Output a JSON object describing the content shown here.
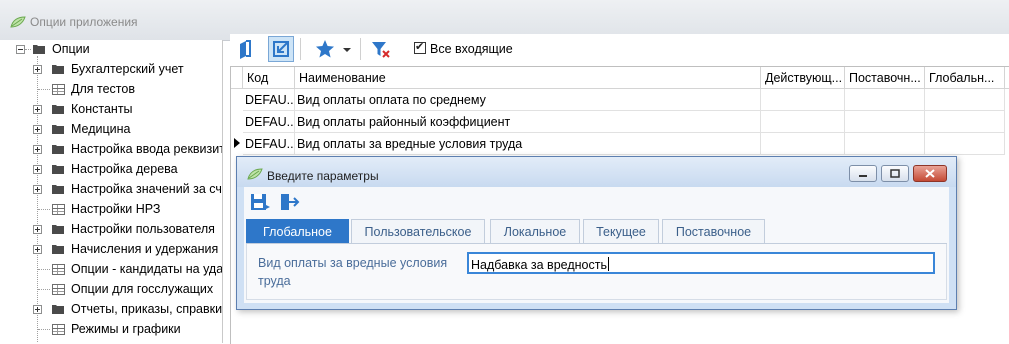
{
  "app": {
    "title": "Опции приложения"
  },
  "tree": {
    "root": "Опции",
    "items": [
      {
        "label": "Бухгалтерский учет",
        "type": "folder"
      },
      {
        "label": "Для тестов",
        "type": "table"
      },
      {
        "label": "Константы",
        "type": "folder"
      },
      {
        "label": "Медицина",
        "type": "folder"
      },
      {
        "label": "Настройка ввода реквизитов",
        "type": "folder"
      },
      {
        "label": "Настройка дерева",
        "type": "folder"
      },
      {
        "label": "Настройка значений за счет",
        "type": "folder"
      },
      {
        "label": "Настройки НРЗ",
        "type": "table"
      },
      {
        "label": "Настройки пользователя",
        "type": "folder"
      },
      {
        "label": "Начисления и удержания",
        "type": "folder"
      },
      {
        "label": "Опции - кандидаты на удаление",
        "type": "table"
      },
      {
        "label": "Опции для госслужащих",
        "type": "table"
      },
      {
        "label": "Отчеты, приказы, справки",
        "type": "folder"
      },
      {
        "label": "Режимы и графики",
        "type": "table"
      }
    ]
  },
  "toolbar": {
    "icons": [
      "book-icon",
      "import-icon",
      "star-icon",
      "dropdown-arrow-icon",
      "filter-clear-icon"
    ],
    "checkbox_label": "Все входящие",
    "checkbox_checked": true
  },
  "grid": {
    "columns": [
      "Код",
      "Наименование",
      "Действующ...",
      "Поставочн...",
      "Глобальн..."
    ],
    "rows": [
      {
        "code": "DEFAU...",
        "name": "Вид оплаты оплата по среднему"
      },
      {
        "code": "DEFAU...",
        "name": "Вид оплаты районный коэффициент"
      },
      {
        "code": "DEFAU...",
        "name": "Вид оплаты за вредные условия труда"
      }
    ],
    "current_row": 2
  },
  "dialog": {
    "title": "Введите параметры",
    "tools": [
      "save-icon",
      "exit-icon"
    ],
    "tabs": [
      "Глобальное",
      "Пользовательское",
      "Локальное",
      "Текущее",
      "Поставочное"
    ],
    "active_tab": 0,
    "field_label": "Вид оплаты за вредные условия труда",
    "field_value": "Надбавка за вредность"
  },
  "colors": {
    "accent": "#2e77c9",
    "dialog_bg": "#cfe0f4",
    "label": "#4a6d9a"
  }
}
